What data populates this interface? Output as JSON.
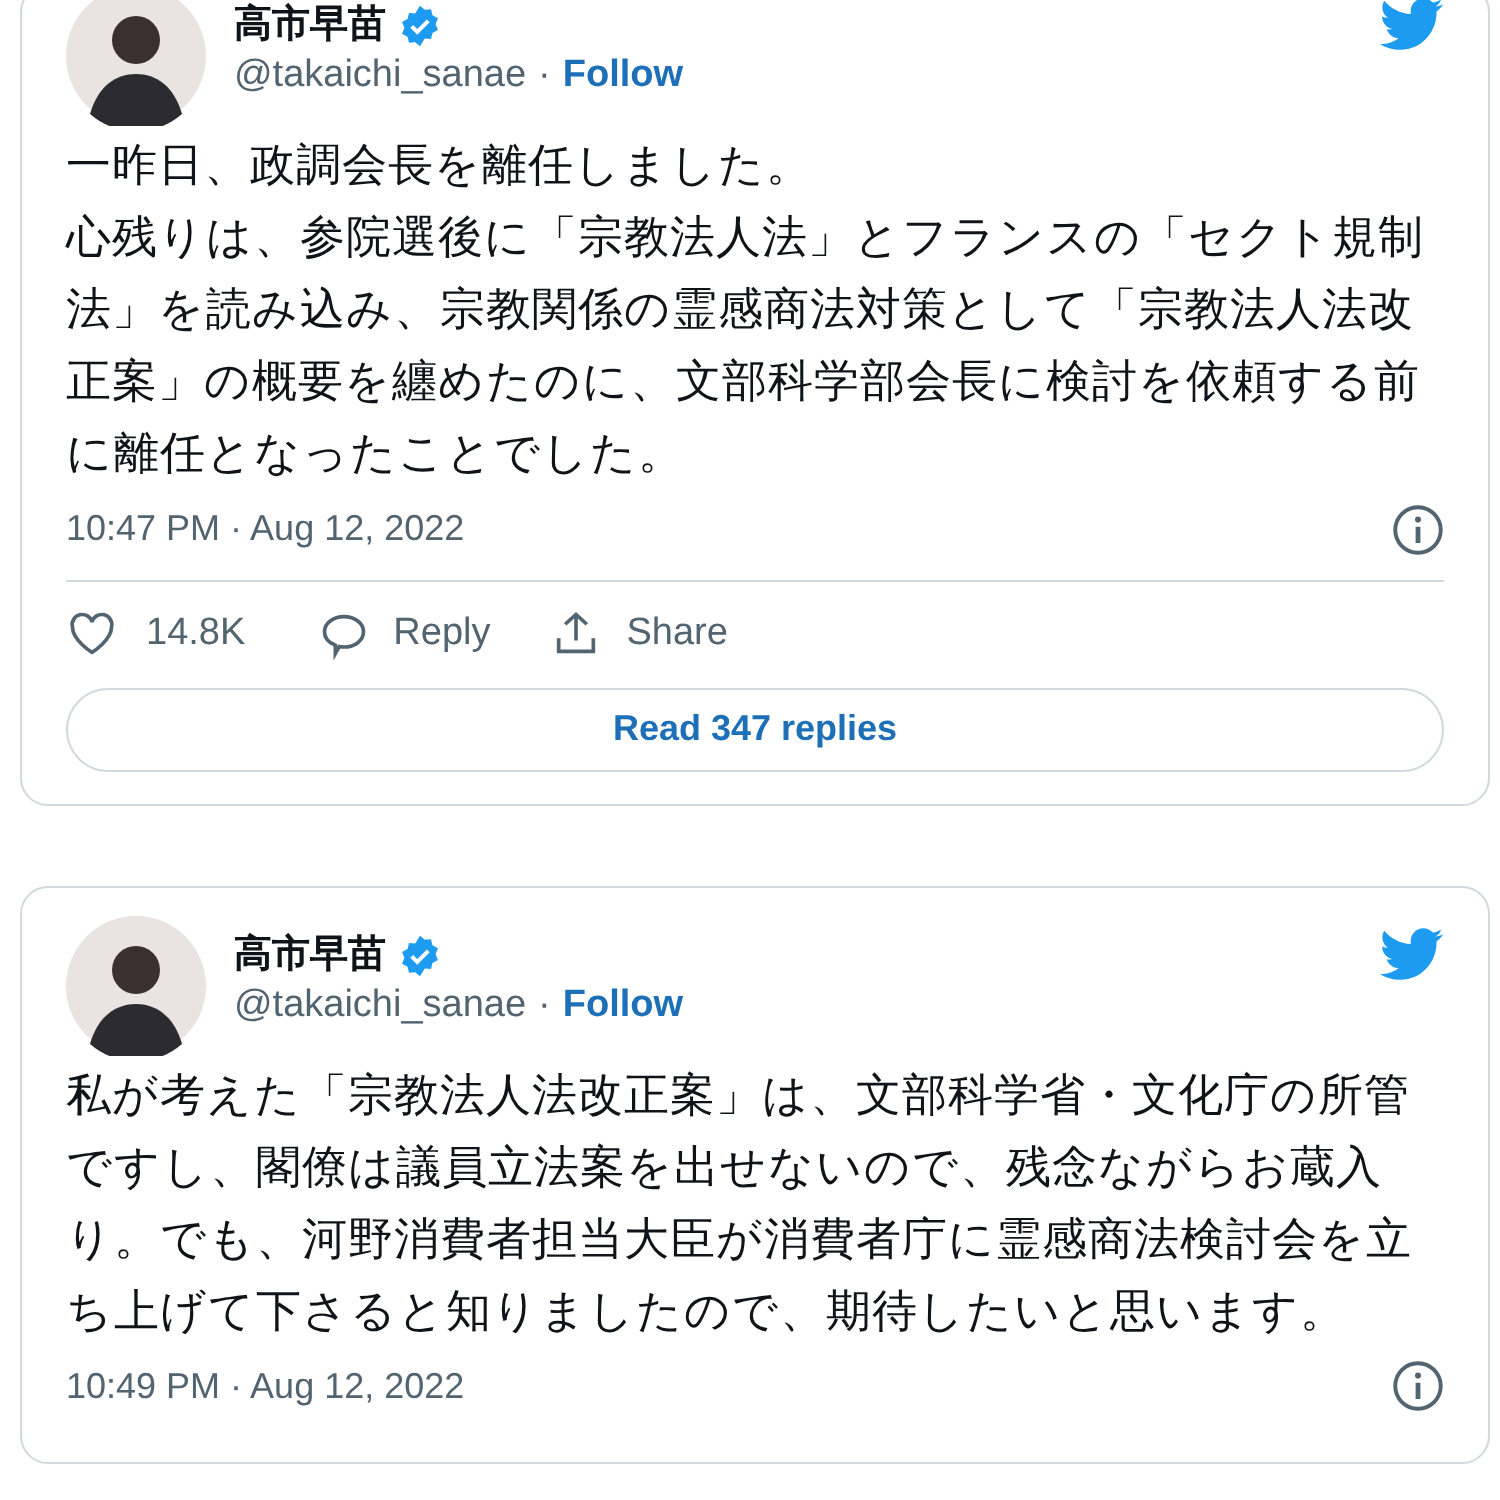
{
  "tweets": [
    {
      "name": "高市早苗",
      "verified": true,
      "handle": "@takaichi_sanae",
      "separator": "·",
      "follow": "Follow",
      "paragraphs": [
        "一昨日、政調会長を離任しました。",
        "心残りは、参院選後に「宗教法人法」とフランスの「セクト規制法」を読み込み、宗教関係の霊感商法対策として「宗教法人法改正案」の概要を纏めたのに、文部科学部会長に検討を依頼する前に離任となったことでした。"
      ],
      "time": "10:47 PM · Aug 12, 2022",
      "likes": "14.8K",
      "reply": "Reply",
      "share": "Share",
      "read_replies": "Read 347 replies"
    },
    {
      "name": "高市早苗",
      "verified": true,
      "handle": "@takaichi_sanae",
      "separator": "·",
      "follow": "Follow",
      "paragraphs": [
        "私が考えた「宗教法人法改正案」は、文部科学省・文化庁の所管ですし、閣僚は議員立法案を出せないので、残念ながらお蔵入り。でも、河野消費者担当大臣が消費者庁に霊感商法検討会を立ち上げて下さると知りましたので、期待したいと思います。"
      ],
      "time": "10:49 PM · Aug 12, 2022"
    }
  ]
}
